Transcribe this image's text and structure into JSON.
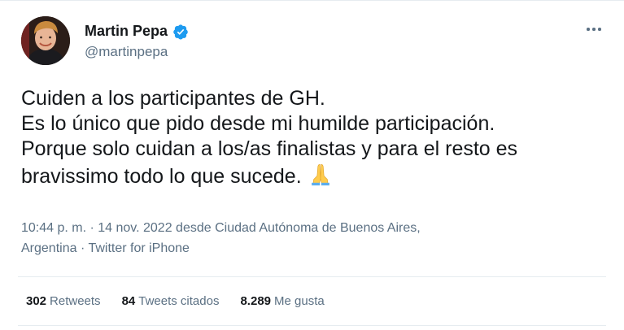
{
  "author": {
    "name": "Martin Pepa",
    "handle": "@martinpepa",
    "verified": true,
    "verified_color": "#1d9bf0"
  },
  "more_icon": "ellipsis-icon",
  "tweet": {
    "lines": [
      "Cuiden a los participantes de GH.",
      "Es lo único que pido desde mi humilde participación.",
      "Porque solo cuidan a los/as finalistas y para el resto es",
      "bravissimo todo lo que sucede."
    ],
    "emoji": "folded-hands-emoji"
  },
  "meta": {
    "line1": "10:44 p. m. · 14 nov. 2022 desde Ciudad Autónoma de Buenos Aires,",
    "line2_place": "Argentina",
    "line2_sep": " · ",
    "line2_source": "Twitter for iPhone"
  },
  "stats": {
    "retweets_count": "302",
    "retweets_label": "Retweets",
    "quotes_count": "84",
    "quotes_label": "Tweets citados",
    "likes_count": "8.289",
    "likes_label": "Me gusta"
  },
  "colors": {
    "text_primary": "#14171a",
    "text_secondary": "#5b7083",
    "divider": "#e6ecf0"
  }
}
